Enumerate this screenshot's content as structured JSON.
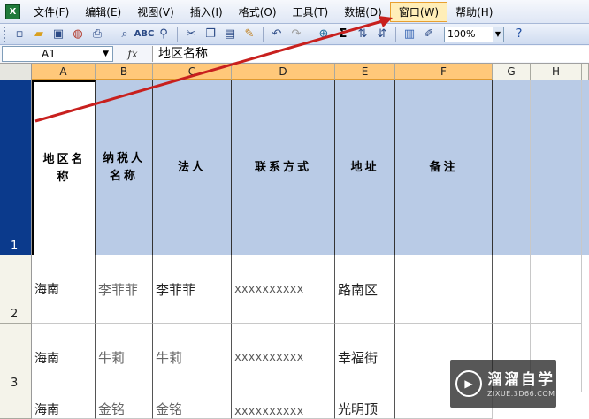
{
  "menubar": {
    "app_icon": "excel-icon",
    "items": [
      {
        "label": "文件(F)",
        "active": false
      },
      {
        "label": "编辑(E)",
        "active": false
      },
      {
        "label": "视图(V)",
        "active": false
      },
      {
        "label": "插入(I)",
        "active": false
      },
      {
        "label": "格式(O)",
        "active": false
      },
      {
        "label": "工具(T)",
        "active": false
      },
      {
        "label": "数据(D)",
        "active": false
      },
      {
        "label": "窗口(W)",
        "active": true
      },
      {
        "label": "帮助(H)",
        "active": false
      }
    ]
  },
  "toolbar": {
    "buttons": [
      "new-icon",
      "open-icon",
      "save-icon",
      "permission-icon",
      "print-icon",
      "print-preview-icon",
      "spelling-icon",
      "research-icon",
      "cut-icon",
      "copy-icon",
      "paste-icon",
      "format-painter-icon",
      "undo-icon",
      "redo-icon",
      "hyperlink-icon",
      "autosum-icon",
      "sort-asc-icon",
      "sort-desc-icon",
      "chart-wizard-icon",
      "drawing-icon"
    ],
    "autosum_glyph": "Σ",
    "zoom": "100%"
  },
  "formula_bar": {
    "name_box": "A1",
    "fx": "fx",
    "content": "地区名称"
  },
  "grid": {
    "columns": [
      "A",
      "B",
      "C",
      "D",
      "E",
      "F",
      "G",
      "H"
    ],
    "rows": [
      "1",
      "2",
      "3"
    ],
    "header_row": [
      "地区名称",
      "纳税人名称",
      "法人",
      "联系方式",
      "地址",
      "备注"
    ],
    "data_rows": [
      [
        "海南",
        "李菲菲",
        "李菲菲",
        "xxxxxxxxxx",
        "路南区"
      ],
      [
        "海南",
        "牛莉",
        "牛莉",
        "xxxxxxxxxx",
        "幸福街"
      ],
      [
        "海南",
        "金铭",
        "金铭",
        "xxxxxxxxxx",
        "光明顶"
      ]
    ]
  },
  "watermark": {
    "title": "溜溜自学",
    "subtitle": "ZIXUE.3D66.COM"
  },
  "colors": {
    "header_fill": "#b9cbe6",
    "selected_row": "#0b3a8c",
    "selected_col": "#ffc87a",
    "arrow": "#c8201e"
  }
}
